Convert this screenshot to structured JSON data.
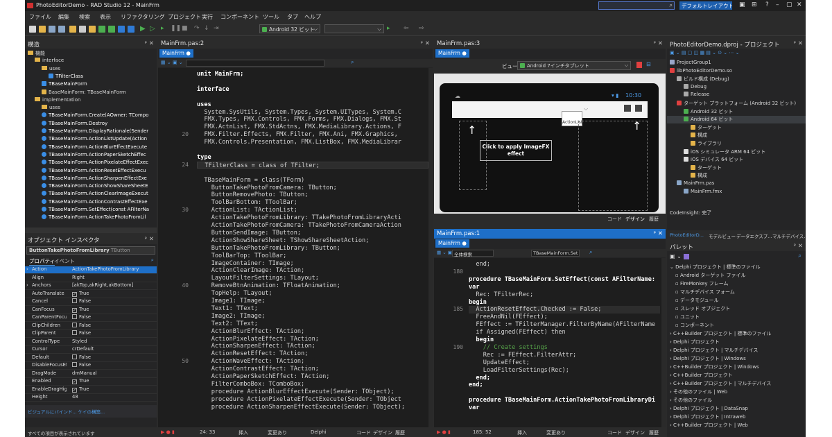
{
  "window": {
    "title": "PhotoEditorDemo - RAD Studio 12 - MainFrm",
    "search_placeholder": "",
    "layout_label": "デフォルトレイアウト ▾"
  },
  "menu": [
    "ファイル",
    "編集",
    "検索",
    "表示",
    "リファクタリング",
    "プロジェクト",
    "実行",
    "コンポーネント",
    "ツール",
    "タブ",
    "ヘルプ"
  ],
  "toolbar": {
    "platform": "Android 32 ビット",
    "config": ""
  },
  "structure": {
    "title": "構造",
    "items": [
      {
        "label": "機能",
        "indent": 0,
        "icon": "folder"
      },
      {
        "label": "interface",
        "indent": 1,
        "icon": "folder"
      },
      {
        "label": "uses",
        "indent": 2,
        "icon": "folder"
      },
      {
        "label": "TFilterClass",
        "indent": 3,
        "icon": "class"
      },
      {
        "label": "TBaseMainForm",
        "indent": 2,
        "icon": "class"
      },
      {
        "label": "BaseMainForm: TBaseMainForm",
        "indent": 2,
        "icon": "var"
      },
      {
        "label": "implementation",
        "indent": 1,
        "icon": "folder"
      },
      {
        "label": "uses",
        "indent": 2,
        "icon": "folder"
      },
      {
        "label": "TBaseMainForm.Create(AOwner: TCompo",
        "indent": 2,
        "icon": "method"
      },
      {
        "label": "TBaseMainForm.Destroy",
        "indent": 2,
        "icon": "method"
      },
      {
        "label": "TBaseMainForm.DisplayRationale(Sender",
        "indent": 2,
        "icon": "method"
      },
      {
        "label": "TBaseMainForm.ActionListUpdate(Action",
        "indent": 2,
        "icon": "method"
      },
      {
        "label": "TBaseMainForm.ActionBlurEffectExecute",
        "indent": 2,
        "icon": "method"
      },
      {
        "label": "TBaseMainForm.ActionPaperSketchEffec",
        "indent": 2,
        "icon": "method"
      },
      {
        "label": "TBaseMainForm.ActionPixelateEffectExec",
        "indent": 2,
        "icon": "method"
      },
      {
        "label": "TBaseMainForm.ActionResetEffectExecu",
        "indent": 2,
        "icon": "method"
      },
      {
        "label": "TBaseMainForm.ActionSharpenEffectExe",
        "indent": 2,
        "icon": "method"
      },
      {
        "label": "TBaseMainForm.ActionShowShareSheetE",
        "indent": 2,
        "icon": "method"
      },
      {
        "label": "TBaseMainForm.ActionClearImageExecut",
        "indent": 2,
        "icon": "method"
      },
      {
        "label": "TBaseMainForm.ActionContrastEffectExe",
        "indent": 2,
        "icon": "method"
      },
      {
        "label": "TBaseMainForm.SetEffect(const AFilterNa",
        "indent": 2,
        "icon": "method"
      },
      {
        "label": "TBaseMainForm.ActionTakePhotoFromLil",
        "indent": 2,
        "icon": "method"
      }
    ]
  },
  "inspector": {
    "title": "オブジェクト インスペクタ",
    "selected": "ButtonTakePhotoFromLibrary",
    "selected_type": "TButton",
    "tab_props": "プロパティ",
    "tab_events": "イベント",
    "rows": [
      {
        "k": "Action",
        "v": "ActionTakePhotoFromLibrary",
        "cb": false,
        "exp": true,
        "hl": true
      },
      {
        "k": "Align",
        "v": "Right",
        "cb": false,
        "exp": false,
        "hl": false
      },
      {
        "k": "Anchors",
        "v": "[akTop,akRight,akBottom]",
        "cb": false,
        "exp": true,
        "hl": false
      },
      {
        "k": "AutoTranslate",
        "v": "True",
        "cb": true,
        "exp": false,
        "hl": false
      },
      {
        "k": "Cancel",
        "v": "False",
        "cb": true,
        "exp": false,
        "hl": false
      },
      {
        "k": "CanFocus",
        "v": "True",
        "cb": true,
        "exp": false,
        "hl": false
      },
      {
        "k": "CanParentFocus",
        "v": "False",
        "cb": true,
        "exp": false,
        "hl": false
      },
      {
        "k": "ClipChildren",
        "v": "False",
        "cb": true,
        "exp": false,
        "hl": false
      },
      {
        "k": "ClipParent",
        "v": "False",
        "cb": true,
        "exp": false,
        "hl": false
      },
      {
        "k": "ControlType",
        "v": "Styled",
        "cb": false,
        "exp": false,
        "hl": false
      },
      {
        "k": "Cursor",
        "v": "crDefault",
        "cb": false,
        "exp": false,
        "hl": false
      },
      {
        "k": "Default",
        "v": "False",
        "cb": true,
        "exp": false,
        "hl": false
      },
      {
        "k": "DisableFocusEffect",
        "v": "False",
        "cb": true,
        "exp": false,
        "hl": false
      },
      {
        "k": "DragMode",
        "v": "dmManual",
        "cb": false,
        "exp": false,
        "hl": false
      },
      {
        "k": "Enabled",
        "v": "True",
        "cb": true,
        "exp": false,
        "hl": false
      },
      {
        "k": "EnableDragHighlight",
        "v": "True",
        "cb": true,
        "exp": false,
        "hl": false
      },
      {
        "k": "Height",
        "v": "48",
        "cb": false,
        "exp": false,
        "hl": false
      }
    ],
    "link": "ビジュアルにバインド... ケイの構築...",
    "status": "すべての項目が表示されています"
  },
  "editor1": {
    "title": "MainFrm.pas:2",
    "tab": "MainFrm",
    "lines": [
      {
        "n": "",
        "t": "unit MainFrm;",
        "k": true
      },
      {
        "n": "",
        "t": ""
      },
      {
        "n": "",
        "t": "interface",
        "k": true
      },
      {
        "n": "",
        "t": ""
      },
      {
        "n": "",
        "t": "uses",
        "k": true
      },
      {
        "n": "",
        "t": "  System.SysUtils, System.Types, System.UITypes, System.C"
      },
      {
        "n": "",
        "t": "  FMX.Types, FMX.Controls, FMX.Forms, FMX.Dialogs, FMX.St"
      },
      {
        "n": "",
        "t": "  FMX.ActnList, FMX.StdActns, FMX.MediaLibrary.Actions, F"
      },
      {
        "n": "20",
        "t": "  FMX.Filter.Effects, FMX.Filter, FMX.Ani, FMX.Graphics,"
      },
      {
        "n": "",
        "t": "  FMX.Controls.Presentation, FMX.ListBox, FMX.MediaLibrar"
      },
      {
        "n": "",
        "t": ""
      },
      {
        "n": "",
        "t": "type",
        "k": true
      },
      {
        "n": "24",
        "t": "  TFilterClass = class of TFilter;",
        "hl": true
      },
      {
        "n": "",
        "t": ""
      },
      {
        "n": "",
        "t": "  TBaseMainForm = class(TForm)"
      },
      {
        "n": "",
        "t": "    ButtonTakePhotoFromCamera: TButton;"
      },
      {
        "n": "",
        "t": "    ButtonRemovePhoto: TButton;"
      },
      {
        "n": "",
        "t": "    ToolBarBottom: TToolBar;"
      },
      {
        "n": "30",
        "t": "    ActionList: TActionList;"
      },
      {
        "n": "",
        "t": "    ActionTakePhotoFromLibrary: TTakePhotoFromLibraryActi"
      },
      {
        "n": "",
        "t": "    ActionTakePhotoFromCamera: TTakePhotoFromCameraAction"
      },
      {
        "n": "",
        "t": "    ButtonSendImage: TButton;"
      },
      {
        "n": "",
        "t": "    ActionShowShareSheet: TShowShareSheetAction;"
      },
      {
        "n": "",
        "t": "    ButtonTakePhotoFromLibrary: TButton;"
      },
      {
        "n": "",
        "t": "    ToolBarTop: TToolBar;"
      },
      {
        "n": "",
        "t": "    ImageContainer: TImage;"
      },
      {
        "n": "",
        "t": "    ActionClearImage: TAction;"
      },
      {
        "n": "",
        "t": "    LayoutFilterSettings: TLayout;"
      },
      {
        "n": "40",
        "t": "    RemoveBtnAnimation: TFloatAnimation;"
      },
      {
        "n": "",
        "t": "    TopHelp: TLayout;"
      },
      {
        "n": "",
        "t": "    Image1: TImage;"
      },
      {
        "n": "",
        "t": "    Text1: TText;"
      },
      {
        "n": "",
        "t": "    Image2: TImage;"
      },
      {
        "n": "",
        "t": "    Text2: TText;"
      },
      {
        "n": "",
        "t": "    ActionBlurEffect: TAction;"
      },
      {
        "n": "",
        "t": "    ActionPixelateEffect: TAction;"
      },
      {
        "n": "",
        "t": "    ActionSharpenEffect: TAction;"
      },
      {
        "n": "",
        "t": "    ActionResetEffect: TAction;"
      },
      {
        "n": "50",
        "t": "    ActionWaveEffect: TAction;"
      },
      {
        "n": "",
        "t": "    ActionContrastEffect: TAction;"
      },
      {
        "n": "",
        "t": "    ActionPaperSketchEffect: TAction;"
      },
      {
        "n": "",
        "t": "    FilterComboBox: TComboBox;"
      },
      {
        "n": "",
        "t": "    procedure ActionBlurEffectExecute(Sender: TObject);"
      },
      {
        "n": "",
        "t": "    procedure ActionPixelateEffectExecute(Sender: TObject"
      },
      {
        "n": "",
        "t": "    procedure ActionSharpenEffectExecute(Sender: TObject);"
      }
    ],
    "status": {
      "pos": "24: 33",
      "mode": "挿入",
      "modified": "変更あり",
      "enc": "Delphi",
      "code": "コード",
      "design": "デザイン",
      "history": "履歴"
    }
  },
  "designer": {
    "title": "MainFrm.pas:3",
    "tab": "MainFrm",
    "view_label": "ビュー:",
    "view_value": "Android 7インチタブレット",
    "time": "10:30",
    "hint": "Click to apply ImageFX effect",
    "actionlist": "ActionList",
    "code": "コード",
    "design": "デザイン",
    "history": "履歴"
  },
  "editor2": {
    "title": "MainFrm.pas:1",
    "tab": "MainFrm",
    "search": "全体検索",
    "func": "TBaseMainForm.Set",
    "lines": [
      {
        "n": "",
        "t": "  end;"
      },
      {
        "n": "180",
        "t": ""
      },
      {
        "n": "",
        "t": "procedure TBaseMainForm.SetEffect(const AFilterName:",
        "k": true
      },
      {
        "n": "",
        "t": "var",
        "k": true
      },
      {
        "n": "",
        "t": "  Rec: TFilterRec;"
      },
      {
        "n": "",
        "t": "begin",
        "k": true
      },
      {
        "n": "185",
        "t": "  ActionResetEffect.Checked := False;",
        "hl": true
      },
      {
        "n": "",
        "t": "  FreeAndNil(FEffect);"
      },
      {
        "n": "",
        "t": "  FEffect := TFilterManager.FilterByName(AFilterName"
      },
      {
        "n": "",
        "t": "  if Assigned(FEffect) then"
      },
      {
        "n": "",
        "t": "  begin",
        "k": true
      },
      {
        "n": "190",
        "t": "    // Create settings",
        "c": true
      },
      {
        "n": "",
        "t": "    Rec := FEffect.FilterAttr;"
      },
      {
        "n": "",
        "t": "    UpdateEffect;"
      },
      {
        "n": "",
        "t": "    LoadFilterSettings(Rec);"
      },
      {
        "n": "",
        "t": "  end;",
        "k": true
      },
      {
        "n": "",
        "t": "end;",
        "k": true
      },
      {
        "n": "",
        "t": ""
      },
      {
        "n": "",
        "t": "procedure TBaseMainForm.ActionTakePhotoFromLibraryDi",
        "k": true
      },
      {
        "n": "",
        "t": "var",
        "k": true
      }
    ],
    "status": {
      "pos": "185: 52",
      "mode": "挿入",
      "modified": "変更あり",
      "code": "コード",
      "design": "デザイン",
      "history": "履歴"
    }
  },
  "project": {
    "title": "PhotoEditorDemo.dproj - プロジェクト",
    "items": [
      {
        "label": "ProjectGroup1",
        "indent": 0,
        "icon": "group",
        "sel": false
      },
      {
        "label": "libPhotoEditorDemo.so",
        "indent": 0,
        "icon": "proj",
        "sel": false
      },
      {
        "label": "ビルド構成 (Debug)",
        "indent": 1,
        "icon": "gear",
        "sel": false
      },
      {
        "label": "Debug",
        "indent": 2,
        "icon": "gear",
        "sel": false
      },
      {
        "label": "Release",
        "indent": 2,
        "icon": "gear",
        "sel": false
      },
      {
        "label": "ターゲット プラットフォーム (Android 32 ビット)",
        "indent": 1,
        "icon": "target",
        "sel": false
      },
      {
        "label": "Android 32 ビット",
        "indent": 2,
        "icon": "android",
        "sel": false
      },
      {
        "label": "Android 64 ビット",
        "indent": 2,
        "icon": "android",
        "sel": true
      },
      {
        "label": "ターゲット",
        "indent": 3,
        "icon": "folder",
        "sel": false
      },
      {
        "label": "構成",
        "indent": 3,
        "icon": "folder",
        "sel": false
      },
      {
        "label": "ライブラリ",
        "indent": 3,
        "icon": "folder",
        "sel": false
      },
      {
        "label": "iOS シミュレータ ARM 64 ビット",
        "indent": 2,
        "icon": "ios",
        "sel": false
      },
      {
        "label": "iOS デバイス 64 ビット",
        "indent": 2,
        "icon": "ios",
        "sel": false
      },
      {
        "label": "ターゲット",
        "indent": 3,
        "icon": "folder",
        "sel": false
      },
      {
        "label": "構成",
        "indent": 3,
        "icon": "folder",
        "sel": false
      },
      {
        "label": "MainFrm.pas",
        "indent": 1,
        "icon": "file",
        "sel": false
      },
      {
        "label": "MainFrm.fmx",
        "indent": 2,
        "icon": "file",
        "sel": false
      }
    ],
    "codeinsight": "CodeInsight: 完了",
    "tabs": [
      "PhotoEditorD...",
      "モデルビュー",
      "データエクスプ...",
      "マルチデバイス..."
    ]
  },
  "palette": {
    "title": "パレット",
    "items": [
      {
        "label": "Delphi プロジェクト | 標準のファイル",
        "exp": true,
        "indent": 0
      },
      {
        "label": "Android ターゲット ファイル",
        "indent": 1
      },
      {
        "label": "FireMonkey フレーム",
        "indent": 1
      },
      {
        "label": "マルチデバイス フォーム",
        "indent": 1
      },
      {
        "label": "データモジュール",
        "indent": 1
      },
      {
        "label": "スレッド オブジェクト",
        "indent": 1
      },
      {
        "label": "ユニット",
        "indent": 1
      },
      {
        "label": "コンポーネント",
        "indent": 1
      },
      {
        "label": "C++Builder プロジェクト | 標準のファイル",
        "indent": 0
      },
      {
        "label": "Delphi プロジェクト",
        "indent": 0
      },
      {
        "label": "Delphi プロジェクト | マルチデバイス",
        "indent": 0
      },
      {
        "label": "Delphi プロジェクト | Windows",
        "indent": 0
      },
      {
        "label": "C++Builder プロジェクト | Windows",
        "indent": 0
      },
      {
        "label": "C++Builder プロジェクト",
        "indent": 0
      },
      {
        "label": "C++Builder プロジェクト | マルチデバイス",
        "indent": 0
      },
      {
        "label": "その他のファイル | Web",
        "indent": 0
      },
      {
        "label": "その他のファイル",
        "indent": 0
      },
      {
        "label": "Delphi プロジェクト | DataSnap",
        "indent": 0
      },
      {
        "label": "Delphi プロジェクト | Intraweb",
        "indent": 0
      },
      {
        "label": "C++Builder プロジェクト | Web",
        "indent": 0
      }
    ]
  },
  "colors": {
    "accent": "#1e6fc8",
    "bg": "#252526",
    "code_bg": "#1e1e1e"
  }
}
